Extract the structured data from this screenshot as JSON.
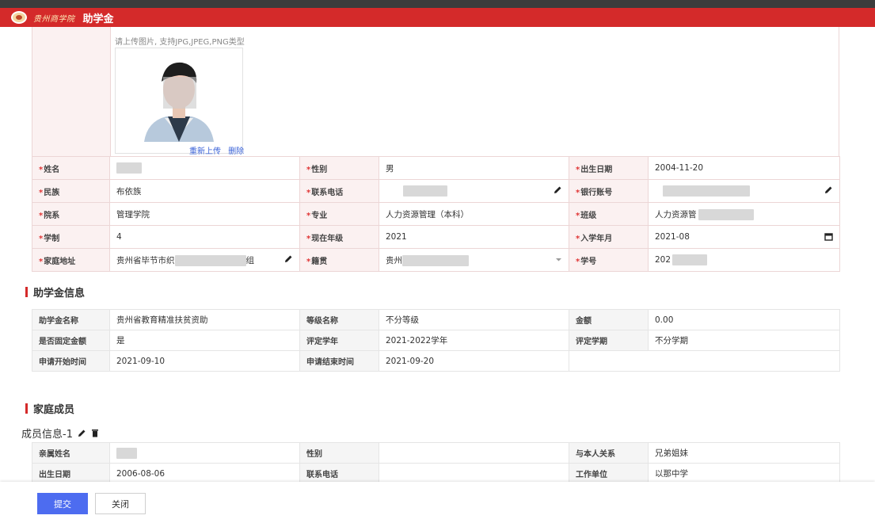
{
  "header": {
    "logo_text": "贵州商学院",
    "title": "助学金"
  },
  "photo": {
    "hint": "请上传图片, 支持JPG,JPEG,PNG类型",
    "reupload": "重新上传",
    "delete": "删除"
  },
  "person": {
    "name_label": "姓名",
    "name_value": "",
    "gender_label": "性别",
    "gender_value": "男",
    "birth_label": "出生日期",
    "birth_value": "2004-11-20",
    "ethnic_label": "民族",
    "ethnic_value": "布依族",
    "phone_label": "联系电话",
    "phone_value": "",
    "bank_label": "银行账号",
    "bank_value": "",
    "college_label": "院系",
    "college_value": "管理学院",
    "major_label": "专业",
    "major_value": "人力资源管理（本科）",
    "class_label": "班级",
    "class_value": "人力资源管",
    "duration_label": "学制",
    "duration_value": "4",
    "grade_label": "现在年级",
    "grade_value": "2021",
    "enroll_label": "入学年月",
    "enroll_value": "2021-08",
    "address_label": "家庭地址",
    "address_value_prefix": "贵州省毕节市织",
    "address_value_suffix": "组",
    "origin_label": "籍贯",
    "origin_value": "贵州",
    "student_id_label": "学号",
    "student_id_value": "202"
  },
  "grant_section": {
    "title": "助学金信息",
    "name_label": "助学金名称",
    "name_value": "贵州省教育精准扶贫资助",
    "level_label": "等级名称",
    "level_value": "不分等级",
    "amount_label": "金额",
    "amount_value": "0.00",
    "fixed_label": "是否固定金额",
    "fixed_value": "是",
    "year_label": "评定学年",
    "year_value": "2021-2022学年",
    "term_label": "评定学期",
    "term_value": "不分学期",
    "start_label": "申请开始时间",
    "start_value": "2021-09-10",
    "end_label": "申请结束时间",
    "end_value": "2021-09-20"
  },
  "family_section": {
    "title": "家庭成员",
    "member_title": "成员信息-1",
    "relative_name_label": "亲属姓名",
    "relative_name_value": "",
    "gender_label": "性别",
    "gender_value": "",
    "relation_label": "与本人关系",
    "relation_value": "兄弟姐妹",
    "birth_label": "出生日期",
    "birth_value": "2006-08-06",
    "phone_label": "联系电话",
    "phone_value": "",
    "work_label": "工作单位",
    "work_value": "以那中学"
  },
  "footer": {
    "submit": "提交",
    "close": "关闭"
  },
  "colors": {
    "header_red": "#d42a2a",
    "primary_blue": "#4d6cf0",
    "required_red": "#e03636"
  }
}
